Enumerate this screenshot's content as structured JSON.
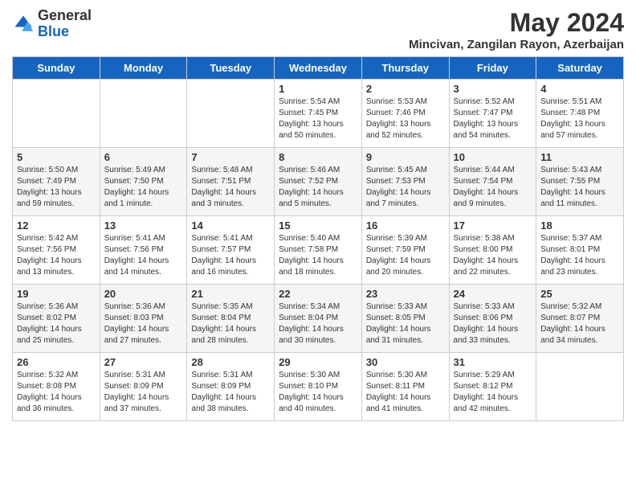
{
  "header": {
    "logo_general": "General",
    "logo_blue": "Blue",
    "title": "May 2024",
    "subtitle": "Mincivan, Zangilan Rayon, Azerbaijan"
  },
  "days_of_week": [
    "Sunday",
    "Monday",
    "Tuesday",
    "Wednesday",
    "Thursday",
    "Friday",
    "Saturday"
  ],
  "weeks": [
    [
      {
        "day": "",
        "info": ""
      },
      {
        "day": "",
        "info": ""
      },
      {
        "day": "",
        "info": ""
      },
      {
        "day": "1",
        "info": "Sunrise: 5:54 AM\nSunset: 7:45 PM\nDaylight: 13 hours\nand 50 minutes."
      },
      {
        "day": "2",
        "info": "Sunrise: 5:53 AM\nSunset: 7:46 PM\nDaylight: 13 hours\nand 52 minutes."
      },
      {
        "day": "3",
        "info": "Sunrise: 5:52 AM\nSunset: 7:47 PM\nDaylight: 13 hours\nand 54 minutes."
      },
      {
        "day": "4",
        "info": "Sunrise: 5:51 AM\nSunset: 7:48 PM\nDaylight: 13 hours\nand 57 minutes."
      }
    ],
    [
      {
        "day": "5",
        "info": "Sunrise: 5:50 AM\nSunset: 7:49 PM\nDaylight: 13 hours\nand 59 minutes."
      },
      {
        "day": "6",
        "info": "Sunrise: 5:49 AM\nSunset: 7:50 PM\nDaylight: 14 hours\nand 1 minute."
      },
      {
        "day": "7",
        "info": "Sunrise: 5:48 AM\nSunset: 7:51 PM\nDaylight: 14 hours\nand 3 minutes."
      },
      {
        "day": "8",
        "info": "Sunrise: 5:46 AM\nSunset: 7:52 PM\nDaylight: 14 hours\nand 5 minutes."
      },
      {
        "day": "9",
        "info": "Sunrise: 5:45 AM\nSunset: 7:53 PM\nDaylight: 14 hours\nand 7 minutes."
      },
      {
        "day": "10",
        "info": "Sunrise: 5:44 AM\nSunset: 7:54 PM\nDaylight: 14 hours\nand 9 minutes."
      },
      {
        "day": "11",
        "info": "Sunrise: 5:43 AM\nSunset: 7:55 PM\nDaylight: 14 hours\nand 11 minutes."
      }
    ],
    [
      {
        "day": "12",
        "info": "Sunrise: 5:42 AM\nSunset: 7:56 PM\nDaylight: 14 hours\nand 13 minutes."
      },
      {
        "day": "13",
        "info": "Sunrise: 5:41 AM\nSunset: 7:56 PM\nDaylight: 14 hours\nand 14 minutes."
      },
      {
        "day": "14",
        "info": "Sunrise: 5:41 AM\nSunset: 7:57 PM\nDaylight: 14 hours\nand 16 minutes."
      },
      {
        "day": "15",
        "info": "Sunrise: 5:40 AM\nSunset: 7:58 PM\nDaylight: 14 hours\nand 18 minutes."
      },
      {
        "day": "16",
        "info": "Sunrise: 5:39 AM\nSunset: 7:59 PM\nDaylight: 14 hours\nand 20 minutes."
      },
      {
        "day": "17",
        "info": "Sunrise: 5:38 AM\nSunset: 8:00 PM\nDaylight: 14 hours\nand 22 minutes."
      },
      {
        "day": "18",
        "info": "Sunrise: 5:37 AM\nSunset: 8:01 PM\nDaylight: 14 hours\nand 23 minutes."
      }
    ],
    [
      {
        "day": "19",
        "info": "Sunrise: 5:36 AM\nSunset: 8:02 PM\nDaylight: 14 hours\nand 25 minutes."
      },
      {
        "day": "20",
        "info": "Sunrise: 5:36 AM\nSunset: 8:03 PM\nDaylight: 14 hours\nand 27 minutes."
      },
      {
        "day": "21",
        "info": "Sunrise: 5:35 AM\nSunset: 8:04 PM\nDaylight: 14 hours\nand 28 minutes."
      },
      {
        "day": "22",
        "info": "Sunrise: 5:34 AM\nSunset: 8:04 PM\nDaylight: 14 hours\nand 30 minutes."
      },
      {
        "day": "23",
        "info": "Sunrise: 5:33 AM\nSunset: 8:05 PM\nDaylight: 14 hours\nand 31 minutes."
      },
      {
        "day": "24",
        "info": "Sunrise: 5:33 AM\nSunset: 8:06 PM\nDaylight: 14 hours\nand 33 minutes."
      },
      {
        "day": "25",
        "info": "Sunrise: 5:32 AM\nSunset: 8:07 PM\nDaylight: 14 hours\nand 34 minutes."
      }
    ],
    [
      {
        "day": "26",
        "info": "Sunrise: 5:32 AM\nSunset: 8:08 PM\nDaylight: 14 hours\nand 36 minutes."
      },
      {
        "day": "27",
        "info": "Sunrise: 5:31 AM\nSunset: 8:09 PM\nDaylight: 14 hours\nand 37 minutes."
      },
      {
        "day": "28",
        "info": "Sunrise: 5:31 AM\nSunset: 8:09 PM\nDaylight: 14 hours\nand 38 minutes."
      },
      {
        "day": "29",
        "info": "Sunrise: 5:30 AM\nSunset: 8:10 PM\nDaylight: 14 hours\nand 40 minutes."
      },
      {
        "day": "30",
        "info": "Sunrise: 5:30 AM\nSunset: 8:11 PM\nDaylight: 14 hours\nand 41 minutes."
      },
      {
        "day": "31",
        "info": "Sunrise: 5:29 AM\nSunset: 8:12 PM\nDaylight: 14 hours\nand 42 minutes."
      },
      {
        "day": "",
        "info": ""
      }
    ]
  ]
}
